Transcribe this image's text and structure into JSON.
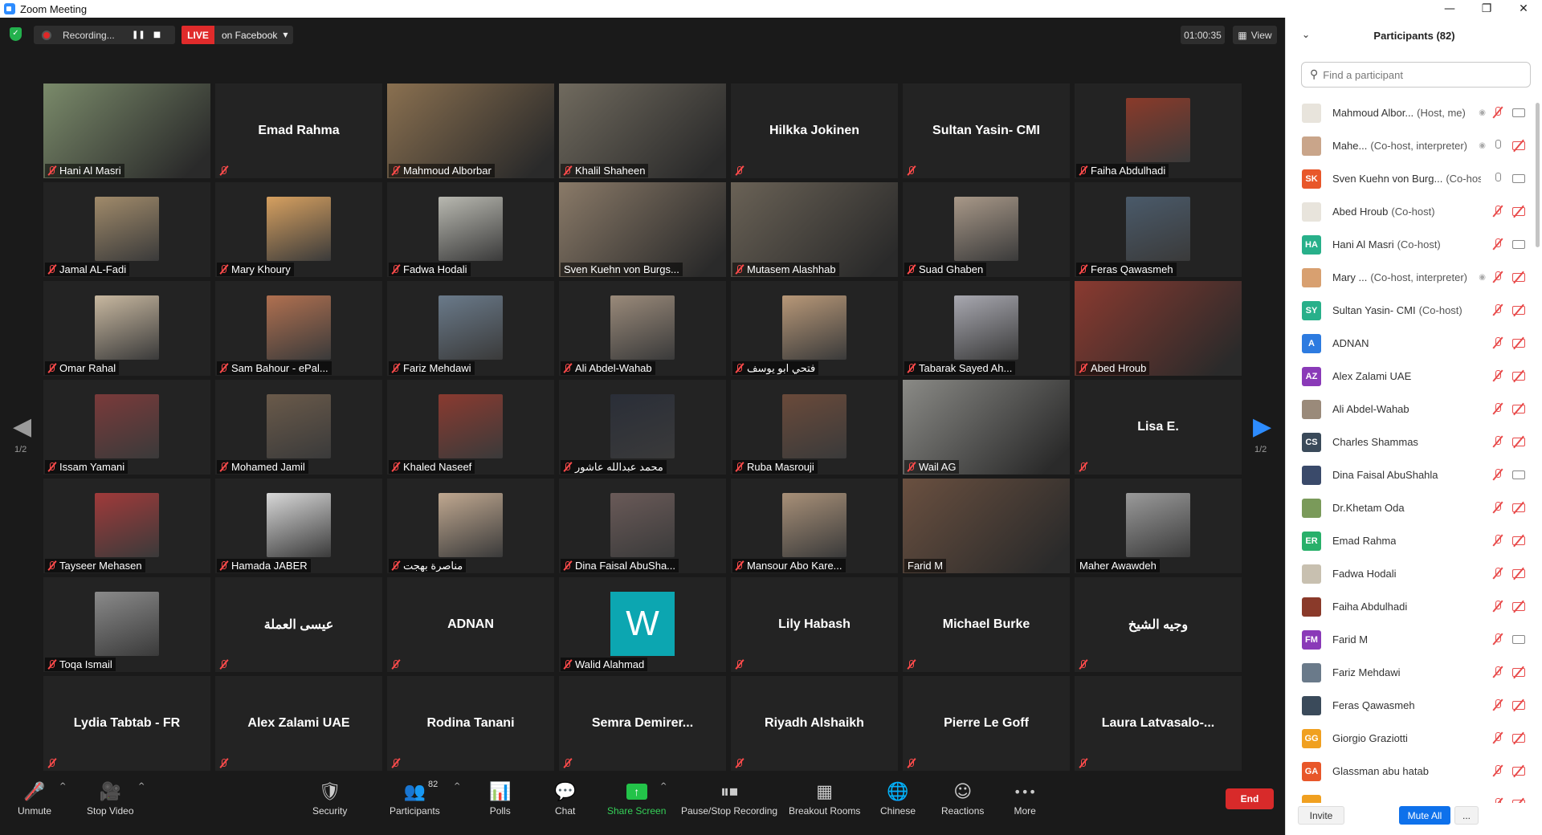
{
  "window": {
    "title": "Zoom Meeting",
    "minimize": "—",
    "restore": "❐",
    "close": "✕"
  },
  "topbar": {
    "recording_text": "Recording...",
    "pause_glyph": "❚❚",
    "stop_glyph": "■",
    "live_label": "LIVE",
    "live_dest": "on Facebook",
    "timer": "01:00:35",
    "view_label": "View"
  },
  "nav": {
    "page_left": "1/2",
    "page_right": "1/2",
    "left_arrow": "◀",
    "right_arrow": "▶"
  },
  "tiles": [
    {
      "name": "Hani Al Masri",
      "kind": "video",
      "color": "#7a8a6a",
      "muted": true
    },
    {
      "name": "Emad Rahma",
      "kind": "name",
      "muted": true
    },
    {
      "name": "Mahmoud Alborbar",
      "kind": "video",
      "color": "#8a7050",
      "muted": true
    },
    {
      "name": "Khalil Shaheen",
      "kind": "video",
      "color": "#706a5e",
      "muted": true
    },
    {
      "name": "Hilkka Jokinen",
      "kind": "name",
      "muted": true
    },
    {
      "name": "Sultan Yasin- CMI",
      "kind": "name",
      "muted": true
    },
    {
      "name": "Faiha Abdulhadi",
      "kind": "photo",
      "color": "#8a3a2a",
      "muted": true
    },
    {
      "name": "Jamal AL-Fadi",
      "kind": "photo",
      "color": "#a08a6a",
      "muted": true
    },
    {
      "name": "Mary Khoury",
      "kind": "photo",
      "color": "#d6a060",
      "muted": true
    },
    {
      "name": "Fadwa Hodali",
      "kind": "photo",
      "color": "#b8b8b0",
      "muted": true
    },
    {
      "name": "Sven Kuehn von Burgs...",
      "kind": "video",
      "color": "#8a7a68",
      "muted": false,
      "active": true
    },
    {
      "name": "Mutasem Alashhab",
      "kind": "video",
      "color": "#6a6256",
      "muted": true
    },
    {
      "name": "Suad Ghaben",
      "kind": "photo",
      "color": "#a89888",
      "muted": true
    },
    {
      "name": "Feras Qawasmeh",
      "kind": "photo",
      "color": "#4a5a6a",
      "muted": true
    },
    {
      "name": "Omar Rahal",
      "kind": "photo",
      "color": "#c8b8a0",
      "muted": true
    },
    {
      "name": "Sam Bahour - ePal...",
      "kind": "photo",
      "color": "#b07050",
      "muted": true
    },
    {
      "name": "Fariz Mehdawi",
      "kind": "photo",
      "color": "#6a7a8a",
      "muted": true
    },
    {
      "name": "Ali Abdel-Wahab",
      "kind": "photo",
      "color": "#9a8a7a",
      "muted": true
    },
    {
      "name": "فتحي ابو يوسف",
      "kind": "photo",
      "color": "#b89878",
      "muted": true
    },
    {
      "name": "Tabarak Sayed Ah...",
      "kind": "photo",
      "color": "#a8a8b0",
      "muted": true
    },
    {
      "name": "Abed Hroub",
      "kind": "video",
      "color": "#8a3a30",
      "muted": true
    },
    {
      "name": "Issam Yamani",
      "kind": "photo",
      "color": "#7a3a3a",
      "muted": true
    },
    {
      "name": "Mohamed Jamil",
      "kind": "photo",
      "color": "#6a5a4a",
      "muted": true
    },
    {
      "name": "Khaled Naseef",
      "kind": "photo",
      "color": "#8a3a30",
      "muted": true
    },
    {
      "name": "محمد عبدالله عاشور",
      "kind": "photo",
      "color": "#2a2e38",
      "muted": true
    },
    {
      "name": "Ruba Masrouji",
      "kind": "photo",
      "color": "#6a4a3a",
      "muted": true
    },
    {
      "name": "Wail AG",
      "kind": "video",
      "color": "#8a8a86",
      "muted": true
    },
    {
      "name": "Lisa E.",
      "kind": "name",
      "muted": true
    },
    {
      "name": "Tayseer Mehasen",
      "kind": "photo",
      "color": "#a03a3a",
      "muted": true
    },
    {
      "name": "Hamada JABER",
      "kind": "photo",
      "color": "#d8d8d8",
      "muted": true
    },
    {
      "name": "مناصرة بهجت",
      "kind": "photo",
      "color": "#c0a890",
      "muted": true
    },
    {
      "name": "Dina Faisal AbuSha...",
      "kind": "photo",
      "color": "#6a5a58",
      "muted": true
    },
    {
      "name": "Mansour Abo Kare...",
      "kind": "photo",
      "color": "#a89078",
      "muted": true
    },
    {
      "name": "Farid M",
      "kind": "video",
      "color": "#6a5040",
      "muted": false
    },
    {
      "name": "Maher Awawdeh",
      "kind": "photo",
      "color": "#9a9a9a",
      "muted": false
    },
    {
      "name": "Toqa Ismail",
      "kind": "photo",
      "color": "#8a8a8a",
      "muted": true
    },
    {
      "name": "عيسى العملة",
      "kind": "name",
      "muted": true
    },
    {
      "name": "ADNAN",
      "kind": "name",
      "muted": true
    },
    {
      "name": "Walid Alahmad",
      "kind": "letter",
      "letter": "W",
      "muted": true
    },
    {
      "name": "Lily Habash",
      "kind": "name",
      "muted": true
    },
    {
      "name": "Michael Burke",
      "kind": "name",
      "muted": true
    },
    {
      "name": "وجيه الشيخ",
      "kind": "name",
      "muted": true
    },
    {
      "name": "Lydia Tabtab - FR",
      "kind": "name",
      "muted": true
    },
    {
      "name": "Alex Zalami UAE",
      "kind": "name",
      "muted": true
    },
    {
      "name": "Rodina Tanani",
      "kind": "name",
      "muted": true
    },
    {
      "name": "Semra  Demirer...",
      "kind": "name",
      "muted": true
    },
    {
      "name": "Riyadh Alshaikh",
      "kind": "name",
      "muted": true
    },
    {
      "name": "Pierre Le Goff",
      "kind": "name",
      "muted": true
    },
    {
      "name": "Laura  Latvasalo-...",
      "kind": "name",
      "muted": true
    }
  ],
  "toolbar": {
    "mute": {
      "icon": "🎤",
      "label": "Unmute"
    },
    "video": {
      "icon": "🎥",
      "label": "Stop Video"
    },
    "security": {
      "icon": "🛡",
      "label": "Security"
    },
    "participants": {
      "icon": "👥",
      "label": "Participants",
      "count": "82"
    },
    "polls": {
      "icon": "📊",
      "label": "Polls"
    },
    "chat": {
      "icon": "💬",
      "label": "Chat"
    },
    "share": {
      "icon": "↑",
      "label": "Share Screen"
    },
    "recording": {
      "icon": "⏸⏹",
      "label": "Pause/Stop Recording"
    },
    "breakout": {
      "icon": "▦",
      "label": "Breakout Rooms"
    },
    "chinese": {
      "icon": "🌐",
      "label": "Chinese"
    },
    "reactions": {
      "icon": "☺",
      "label": "Reactions"
    },
    "more": {
      "icon": "•••",
      "label": "More"
    },
    "end": "End",
    "caret": "^"
  },
  "panel": {
    "title": "Participants (82)",
    "collapse": "⌄",
    "search_placeholder": "Find a participant",
    "search_icon": "⚲",
    "invite": "Invite",
    "mute_all": "Mute All",
    "more": "...",
    "participants": [
      {
        "name": "Mahmoud Albor...",
        "tag": "(Host, me)",
        "avatar": "",
        "color": "#e8e4dc",
        "mic": false,
        "cam": true,
        "extra": "◉"
      },
      {
        "name": "Mahe...",
        "tag": "(Co-host, interpreter)",
        "avatar": "",
        "color": "#c9a58a",
        "mic": true,
        "cam": false,
        "extra": "◉"
      },
      {
        "name": "Sven Kuehn von Burg...",
        "tag": "(Co-host)",
        "avatar": "SK",
        "color": "#e8572a",
        "mic": true,
        "cam": true,
        "extra": ""
      },
      {
        "name": "Abed Hroub",
        "tag": "(Co-host)",
        "avatar": "",
        "color": "#e8e4dc",
        "mic": false,
        "cam": false,
        "extra": ""
      },
      {
        "name": "Hani Al Masri",
        "tag": "(Co-host)",
        "avatar": "HA",
        "color": "#28b08a",
        "mic": false,
        "cam": true,
        "extra": ""
      },
      {
        "name": "Mary ...",
        "tag": "(Co-host, interpreter)",
        "avatar": "",
        "color": "#d8a070",
        "mic": false,
        "cam": false,
        "extra": "◉"
      },
      {
        "name": "Sultan Yasin- CMI",
        "tag": "(Co-host)",
        "avatar": "SY",
        "color": "#28b08a",
        "mic": false,
        "cam": false,
        "extra": ""
      },
      {
        "name": "ADNAN",
        "tag": "",
        "avatar": "A",
        "color": "#2d7be0",
        "mic": false,
        "cam": false,
        "extra": ""
      },
      {
        "name": "Alex Zalami UAE",
        "tag": "",
        "avatar": "AZ",
        "color": "#8a3ab8",
        "mic": false,
        "cam": false,
        "extra": ""
      },
      {
        "name": "Ali Abdel-Wahab",
        "tag": "",
        "avatar": "",
        "color": "#9a8a7a",
        "mic": false,
        "cam": false,
        "extra": ""
      },
      {
        "name": "Charles Shammas",
        "tag": "",
        "avatar": "CS",
        "color": "#3a4a5a",
        "mic": false,
        "cam": false,
        "extra": ""
      },
      {
        "name": "Dina Faisal AbuShahla",
        "tag": "",
        "avatar": "",
        "color": "#3a4a6a",
        "mic": false,
        "cam": true,
        "extra": ""
      },
      {
        "name": "Dr.Khetam Oda",
        "tag": "",
        "avatar": "",
        "color": "#7a9a5a",
        "mic": false,
        "cam": false,
        "extra": ""
      },
      {
        "name": "Emad Rahma",
        "tag": "",
        "avatar": "ER",
        "color": "#28b06a",
        "mic": false,
        "cam": false,
        "extra": ""
      },
      {
        "name": "Fadwa Hodali",
        "tag": "",
        "avatar": "",
        "color": "#c8c0b0",
        "mic": false,
        "cam": false,
        "extra": ""
      },
      {
        "name": "Faiha Abdulhadi",
        "tag": "",
        "avatar": "",
        "color": "#8a3a2a",
        "mic": false,
        "cam": false,
        "extra": ""
      },
      {
        "name": "Farid M",
        "tag": "",
        "avatar": "FM",
        "color": "#8a3ab8",
        "mic": false,
        "cam": true,
        "extra": ""
      },
      {
        "name": "Fariz Mehdawi",
        "tag": "",
        "avatar": "",
        "color": "#6a7a8a",
        "mic": false,
        "cam": false,
        "extra": ""
      },
      {
        "name": "Feras Qawasmeh",
        "tag": "",
        "avatar": "",
        "color": "#3a4a5a",
        "mic": false,
        "cam": false,
        "extra": ""
      },
      {
        "name": "Giorgio Graziotti",
        "tag": "",
        "avatar": "GG",
        "color": "#f0a020",
        "mic": false,
        "cam": false,
        "extra": ""
      },
      {
        "name": "Glassman abu hatab",
        "tag": "",
        "avatar": "GA",
        "color": "#e8572a",
        "mic": false,
        "cam": false,
        "extra": ""
      },
      {
        "name": "",
        "tag": "",
        "avatar": "",
        "color": "#f0a020",
        "mic": false,
        "cam": false,
        "extra": ""
      }
    ]
  }
}
